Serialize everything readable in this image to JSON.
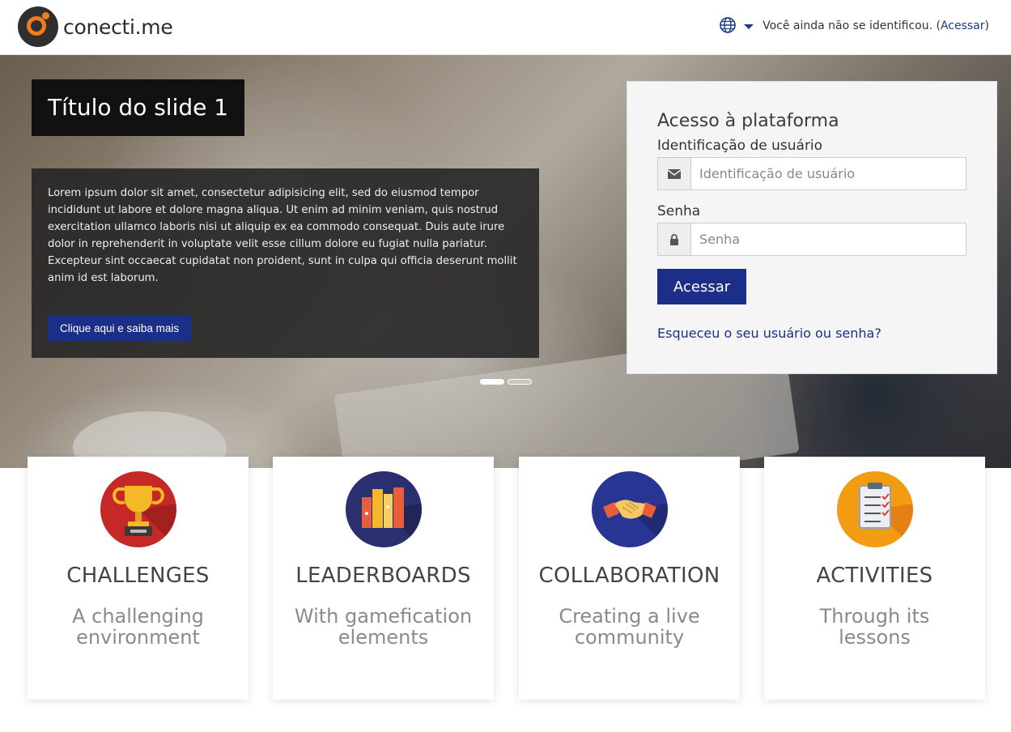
{
  "header": {
    "logo_text": "conecti.me",
    "status_text": "Você ainda não se identificou. (",
    "status_link": "Acessar",
    "status_close": ")"
  },
  "slide": {
    "title": "Título do slide 1",
    "text": "Lorem ipsum dolor sit amet, consectetur adipisicing elit, sed do eiusmod tempor incididunt ut labore et dolore magna aliqua. Ut enim ad minim veniam, quis nostrud exercitation ullamco laboris nisi ut aliquip ex ea commodo consequat. Duis aute irure dolor in reprehenderit in voluptate velit esse cillum dolore eu fugiat nulla pariatur. Excepteur sint occaecat cupidatat non proident, sunt in culpa qui officia deserunt mollit anim id est laborum.",
    "button": "Clique aqui e saiba mais"
  },
  "login": {
    "heading": "Acesso à plataforma",
    "username_label": "Identificação de usuário",
    "username_placeholder": "Identificação de usuário",
    "password_label": "Senha",
    "password_placeholder": "Senha",
    "submit": "Acessar",
    "forgot": "Esqueceu o seu usuário ou senha?"
  },
  "cards": [
    {
      "title": "CHALLENGES",
      "subtitle": "A challenging environment",
      "icon": "trophy-icon",
      "color": "#c62828"
    },
    {
      "title": "LEADERBOARDS",
      "subtitle": "With gamefication elements",
      "icon": "books-icon",
      "color": "#2a2f6e"
    },
    {
      "title": "COLLABORATION",
      "subtitle": "Creating a live community",
      "icon": "handshake-icon",
      "color": "#283593"
    },
    {
      "title": "ACTIVITIES",
      "subtitle": "Through its lessons",
      "icon": "clipboard-icon",
      "color": "#f39c12"
    }
  ],
  "colors": {
    "primary": "#1c2f88",
    "accent": "#f07d1a"
  }
}
